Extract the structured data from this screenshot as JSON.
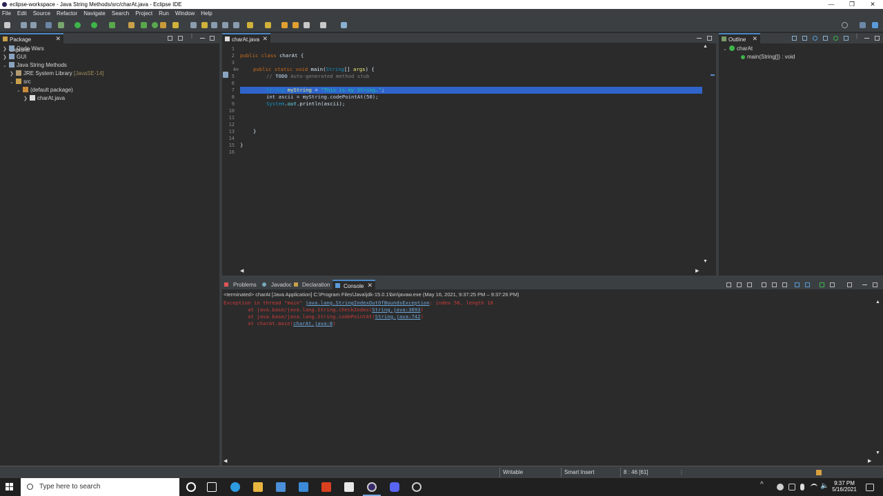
{
  "window": {
    "title": "eclipse-workspace - Java String Methods/src/charAt.java - Eclipse IDE",
    "minimize": "—",
    "maximize": "❐",
    "close": "✕"
  },
  "menu": [
    "File",
    "Edit",
    "Source",
    "Refactor",
    "Navigate",
    "Search",
    "Project",
    "Run",
    "Window",
    "Help"
  ],
  "package_explorer": {
    "title": "Package Explorer",
    "close": "✕",
    "items": [
      {
        "label": "Code Wars",
        "decor": ""
      },
      {
        "label": "GUI",
        "decor": ""
      },
      {
        "label": "Java String Methods",
        "decor": ""
      },
      {
        "label": "JRE System Library",
        "decor": "[JavaSE-14]"
      },
      {
        "label": "src",
        "decor": ""
      },
      {
        "label": "(default package)",
        "decor": ""
      },
      {
        "label": "charAt.java",
        "decor": ""
      }
    ]
  },
  "editor": {
    "tab_label": "charAt.java",
    "close": "✕",
    "line_numbers": [
      "1",
      "2",
      "3",
      "4⊖",
      "5",
      "6",
      "7",
      "8",
      "9",
      "10",
      "11",
      "12",
      "13",
      "14",
      "15",
      "16"
    ],
    "lines": {
      "l2_kw1": "public",
      "l2_kw2": "class",
      "l2_name": "charAt",
      "l2_rest": " {",
      "l4_kw1": "public",
      "l4_kw2": "static",
      "l4_kw3": "void",
      "l4_name": "main",
      "l4_type": "String",
      "l4_args": "args",
      "l4_rest": ") {",
      "l5_comment": "// ",
      "l5_todo": "TODO",
      "l5_rest": " Auto-generated method stub",
      "l7_type": "String",
      "l7_var": "myString",
      "l7_eq": " = ",
      "l7_str": "\"This is my String.\"",
      "l7_end": ";",
      "l8_text": "int ascii = myString.codePointAt(50);",
      "l9_type": "System",
      "l9_out": "out",
      "l9_rest": ".println(ascii);",
      "l13": "}",
      "l15": "}"
    }
  },
  "outline": {
    "title": "Outline",
    "close": "✕",
    "class_name": "charAt",
    "method": "main(String[]) : void"
  },
  "bottom_tabs": {
    "problems": "Problems",
    "javadoc": "Javadoc",
    "declaration": "Declaration",
    "console": "Console",
    "close": "✕"
  },
  "console": {
    "header": "<terminated> charAt [Java Application] C:\\Program Files\\Java\\jdk-15.0.1\\bin\\javaw.exe  (May 16, 2021, 9:37:25 PM – 9:37:26 PM)",
    "l1_pre": "Exception in thread \"main\" ",
    "l1_link": "java.lang.StringIndexOutOfBoundsException",
    "l1_post": ": index 50, length 18",
    "l2_pre": "\tat java.base/java.lang.String.checkIndex(",
    "l2_link": "String.java:3693",
    "l2_post": ")",
    "l3_pre": "\tat java.base/java.lang.String.codePointAt(",
    "l3_link": "String.java:742",
    "l3_post": ")",
    "l4_pre": "\tat charAt.main(",
    "l4_link": "charAt.java:8",
    "l4_post": ")"
  },
  "status": {
    "writable": "Writable",
    "insert_mode": "Smart Insert",
    "position": "8 : 46 [61]"
  },
  "taskbar": {
    "search_placeholder": "Type here to search",
    "time": "9:37 PM",
    "date": "5/16/2021"
  },
  "colors": {
    "accent": "#4a88c7",
    "selection": "#2f65ca",
    "error_text": "#cc3b3b",
    "link": "#6fa8dc"
  }
}
